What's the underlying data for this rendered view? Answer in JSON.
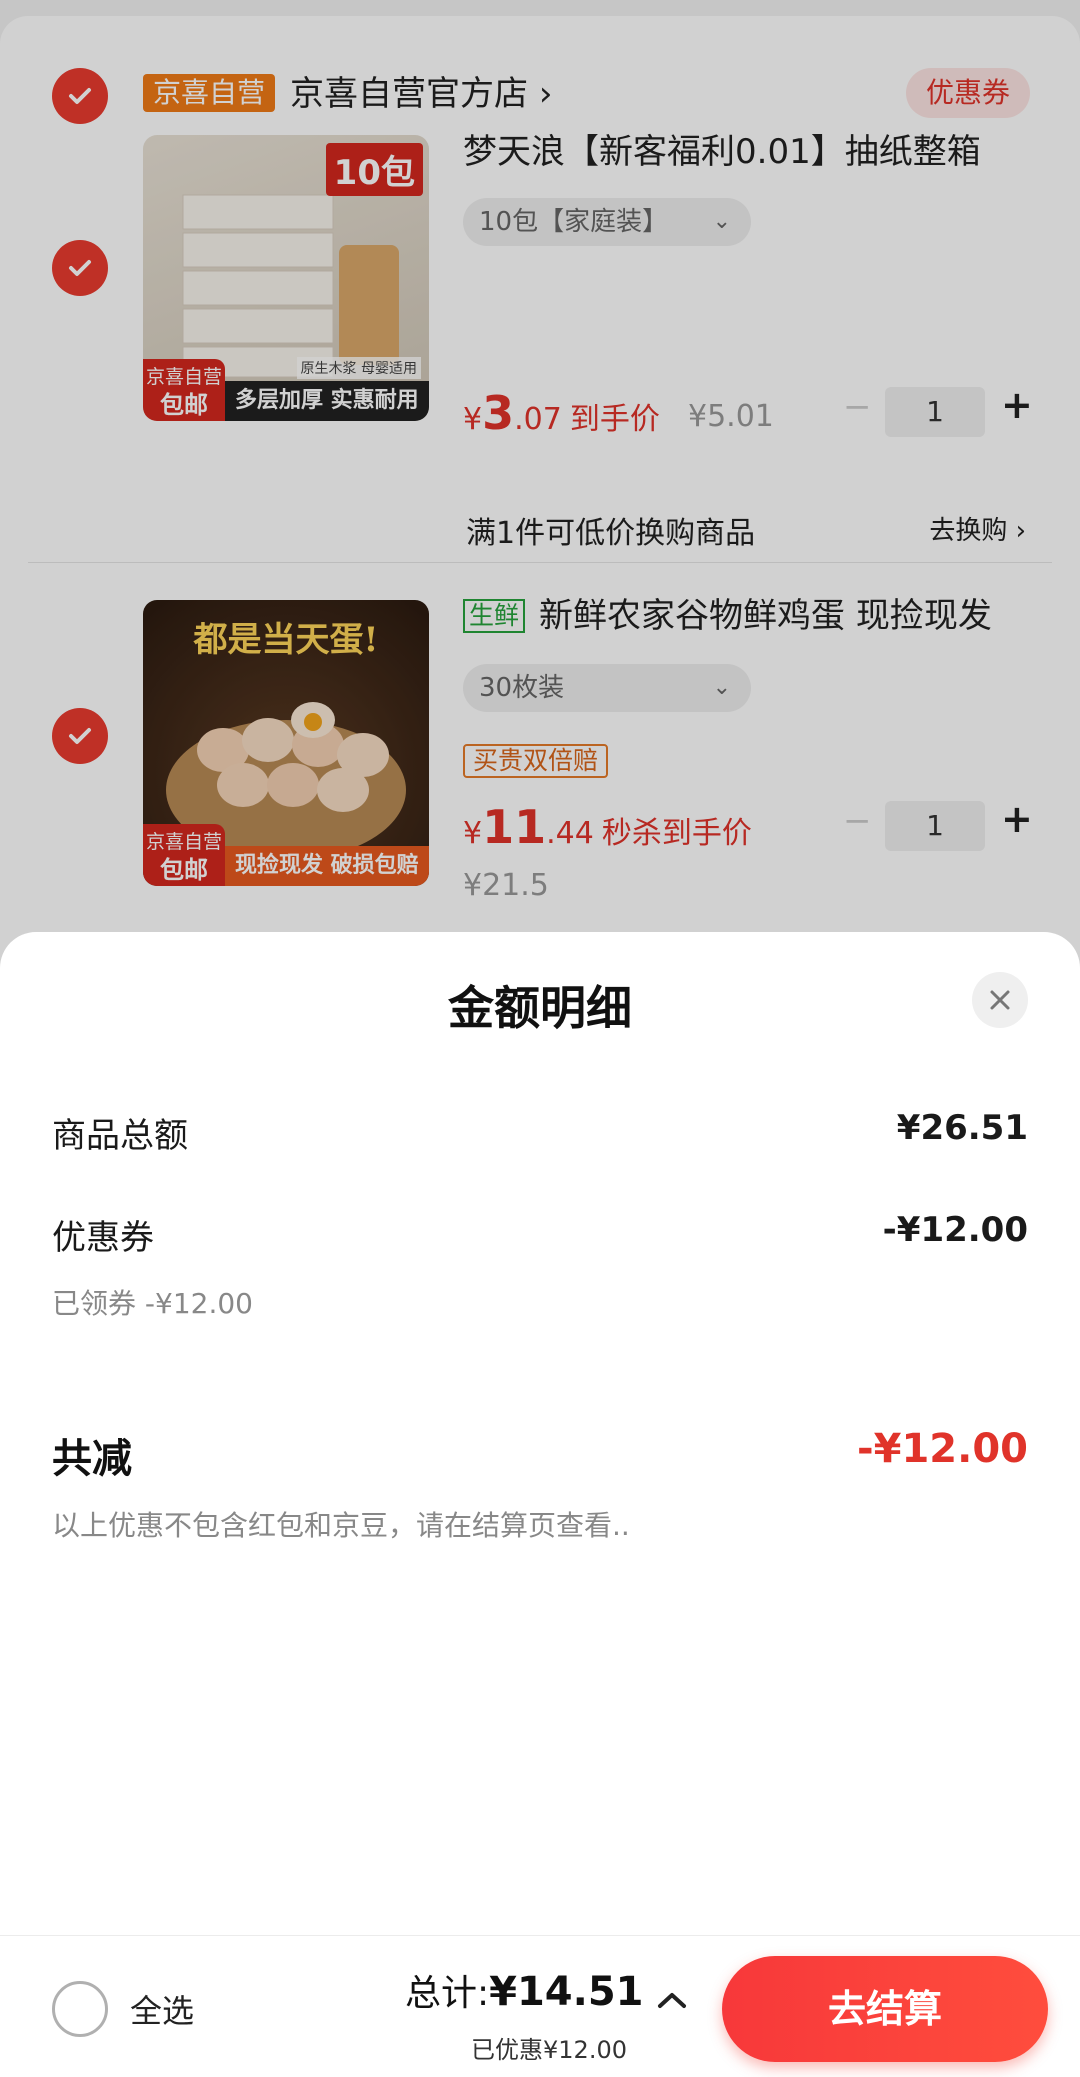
{
  "store": {
    "tag": "京喜自营",
    "name": "京喜自营官方店",
    "arrow": "›",
    "coupon": "优惠券"
  },
  "products": [
    {
      "title": "梦天浪【新客福利0.01】抽纸整箱",
      "spec": "10包【家庭装】",
      "thumb_badge_line1": "京喜自营",
      "thumb_badge_line2": "包邮",
      "thumb_corner": "10包",
      "thumb_strip": "多层加厚 实惠耐用",
      "thumb_caption": "原生木浆 母婴适用",
      "price_yen": "¥",
      "price_int": "3",
      "price_dec": ".07",
      "price_label": "到手价",
      "orig_price": "¥5.01",
      "qty": "1",
      "promo": "满1件可低价换购商品",
      "promo_link": "去换购 ›"
    },
    {
      "tag": "生鲜",
      "title": "新鲜农家谷物鲜鸡蛋 现捡现发",
      "spec": "30枚装",
      "guarantee": "买贵双倍赔",
      "thumb_headline": "都是当天蛋!",
      "thumb_badge_line1": "京喜自营",
      "thumb_badge_line2": "包邮",
      "thumb_strip": "现捡现发 破损包赔",
      "price_yen": "¥",
      "price_int": "11",
      "price_dec": ".44",
      "price_label": "秒杀到手价",
      "orig_price": "¥21.5",
      "qty": "1"
    }
  ],
  "sheet": {
    "title": "金额明细",
    "rows": [
      {
        "label": "商品总额",
        "value": "¥26.51"
      },
      {
        "label": "优惠券",
        "value": "-¥12.00",
        "sub": "已领券 -¥12.00"
      }
    ],
    "total_label": "共减",
    "total_value": "-¥12.00",
    "note": "以上优惠不包含红包和京豆，请在结算页查看.."
  },
  "bottom": {
    "select_all": "全选",
    "sum_label": "总计:",
    "sum_value": "¥14.51",
    "saved": "已优惠¥12.00",
    "checkout": "去结算"
  },
  "colors": {
    "accent": "#e0332a",
    "checkout": "#f7383a"
  }
}
